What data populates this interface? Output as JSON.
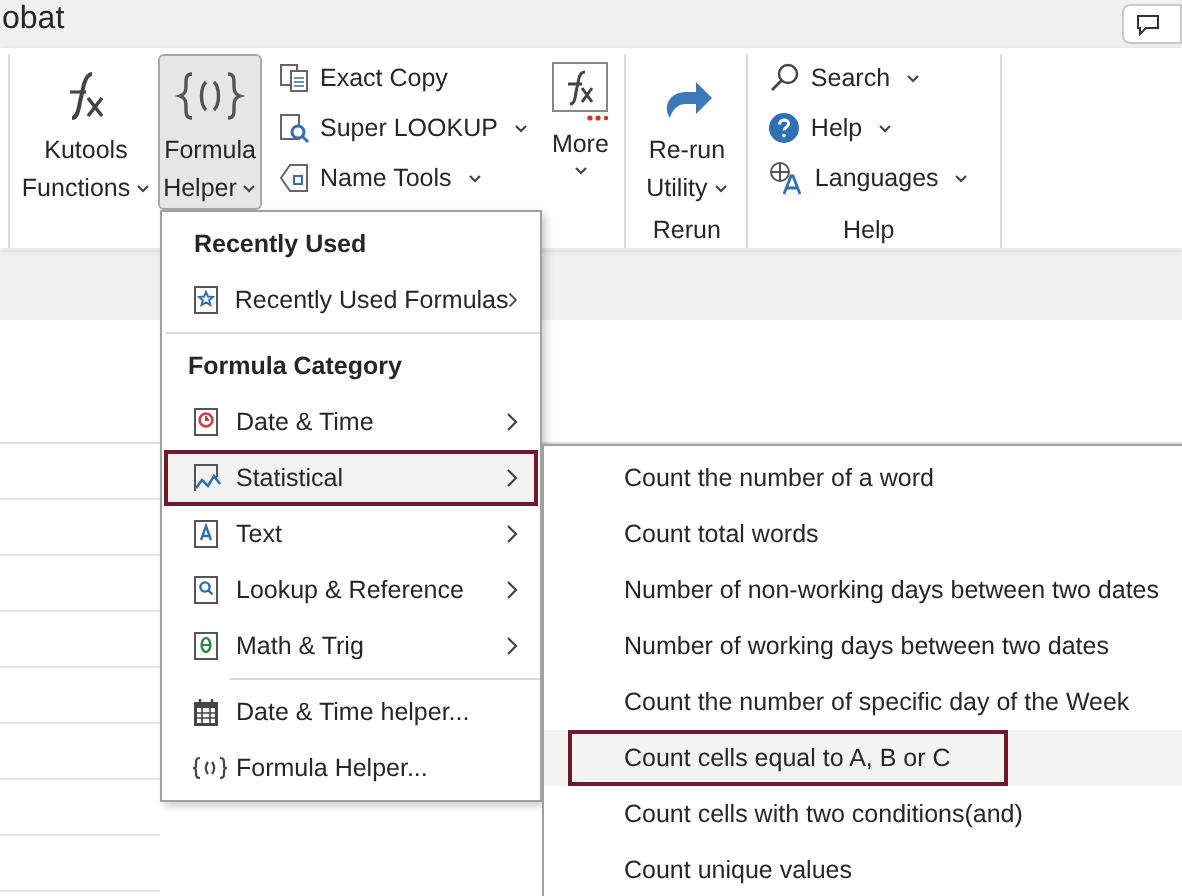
{
  "title_bar": {
    "text": "obat"
  },
  "ribbon": {
    "groups": [
      {
        "large_buttons": [
          {
            "lines": [
              "Kutools",
              "Functions"
            ],
            "dropdown": true,
            "pressed": false
          },
          {
            "lines": [
              "Formula",
              "Helper"
            ],
            "dropdown": true,
            "pressed": true
          }
        ],
        "small_buttons": [
          {
            "label": "Exact Copy",
            "dropdown": false
          },
          {
            "label": "Super LOOKUP",
            "dropdown": true
          },
          {
            "label": "Name Tools",
            "dropdown": true
          }
        ],
        "more_button": {
          "label": "More",
          "dropdown": true
        }
      },
      {
        "label": "Rerun",
        "large_buttons": [
          {
            "lines": [
              "Re-run",
              "Utility"
            ],
            "dropdown": true,
            "pressed": false
          }
        ]
      },
      {
        "label": "Help",
        "small_buttons": [
          {
            "label": "Search",
            "dropdown": true
          },
          {
            "label": "Help",
            "dropdown": true
          },
          {
            "label": "Languages",
            "dropdown": true
          }
        ]
      }
    ]
  },
  "formula_menu": {
    "items": [
      {
        "kind": "heading",
        "label": "Recently Used"
      },
      {
        "kind": "item",
        "label": "Recently Used Formulas",
        "submenu": true,
        "selected": false
      },
      {
        "kind": "separator"
      },
      {
        "kind": "heading",
        "label": "Formula Category"
      },
      {
        "kind": "item",
        "label": "Date & Time",
        "submenu": true,
        "selected": false
      },
      {
        "kind": "item",
        "label": "Statistical",
        "submenu": true,
        "selected": true
      },
      {
        "kind": "item",
        "label": "Text",
        "submenu": true,
        "selected": false
      },
      {
        "kind": "item",
        "label": "Lookup & Reference",
        "submenu": true,
        "selected": false
      },
      {
        "kind": "item",
        "label": "Math & Trig",
        "submenu": true,
        "selected": false
      },
      {
        "kind": "separator"
      },
      {
        "kind": "item",
        "label": "Date & Time helper...",
        "submenu": false,
        "selected": false
      },
      {
        "kind": "item",
        "label": "Formula Helper...",
        "submenu": false,
        "selected": false
      }
    ]
  },
  "statistical_submenu": {
    "items": [
      {
        "label": "Count the number of a word",
        "selected": false
      },
      {
        "label": "Count total words",
        "selected": false
      },
      {
        "label": "Number of non-working days between two dates",
        "selected": false
      },
      {
        "label": "Number of working days between two dates",
        "selected": false
      },
      {
        "label": "Count the number of specific day of the Week",
        "selected": false
      },
      {
        "label": "Count cells equal to A, B or C",
        "selected": true
      },
      {
        "label": "Count cells with two conditions(and)",
        "selected": false
      },
      {
        "label": "Count unique values",
        "selected": false
      }
    ]
  }
}
